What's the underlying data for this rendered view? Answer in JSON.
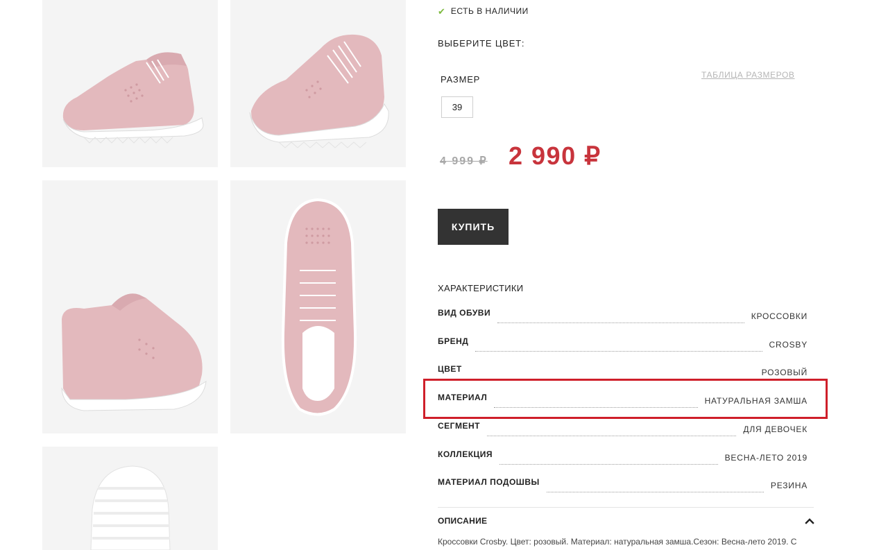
{
  "stock": {
    "icon": "check-icon",
    "label": "ЕСТЬ В НАЛИЧИИ"
  },
  "color_select": {
    "label": "ВЫБЕРИТЕ ЦВЕТ:"
  },
  "size": {
    "label": "РАЗМЕР",
    "table_link": "ТАБЛИЦА РАЗМЕРОВ",
    "options": [
      "39"
    ]
  },
  "price": {
    "old": "4 999 ₽",
    "new": "2 990 ₽"
  },
  "buy_button": {
    "label": "КУПИТЬ"
  },
  "specs": {
    "heading": "ХАРАКТЕРИСТИКИ",
    "rows": [
      {
        "name": "ВИД ОБУВИ",
        "value": "КРОССОВКИ"
      },
      {
        "name": "БРЕНД",
        "value": "CROSBY"
      },
      {
        "name": "ЦВЕТ",
        "value": "РОЗОВЫЙ"
      },
      {
        "name": "МАТЕРИАЛ",
        "value": "НАТУРАЛЬНАЯ ЗАМША"
      },
      {
        "name": "СЕГМЕНТ",
        "value": "ДЛЯ ДЕВОЧЕК"
      },
      {
        "name": "КОЛЛЕКЦИЯ",
        "value": "ВЕСНА-ЛЕТО 2019"
      },
      {
        "name": "МАТЕРИАЛ ПОДОШВЫ",
        "value": "РЕЗИНА"
      }
    ]
  },
  "description": {
    "title": "ОПИСАНИЕ",
    "text": "Кроссовки Crosby. Цвет: розовый. Материал: натуральная замша.Сезон: Весна-лето 2019. С"
  },
  "colors": {
    "accent_price": "#c8343c",
    "highlight": "#cf1f2a",
    "button_bg": "#333333",
    "in_stock": "#7dba3f"
  }
}
